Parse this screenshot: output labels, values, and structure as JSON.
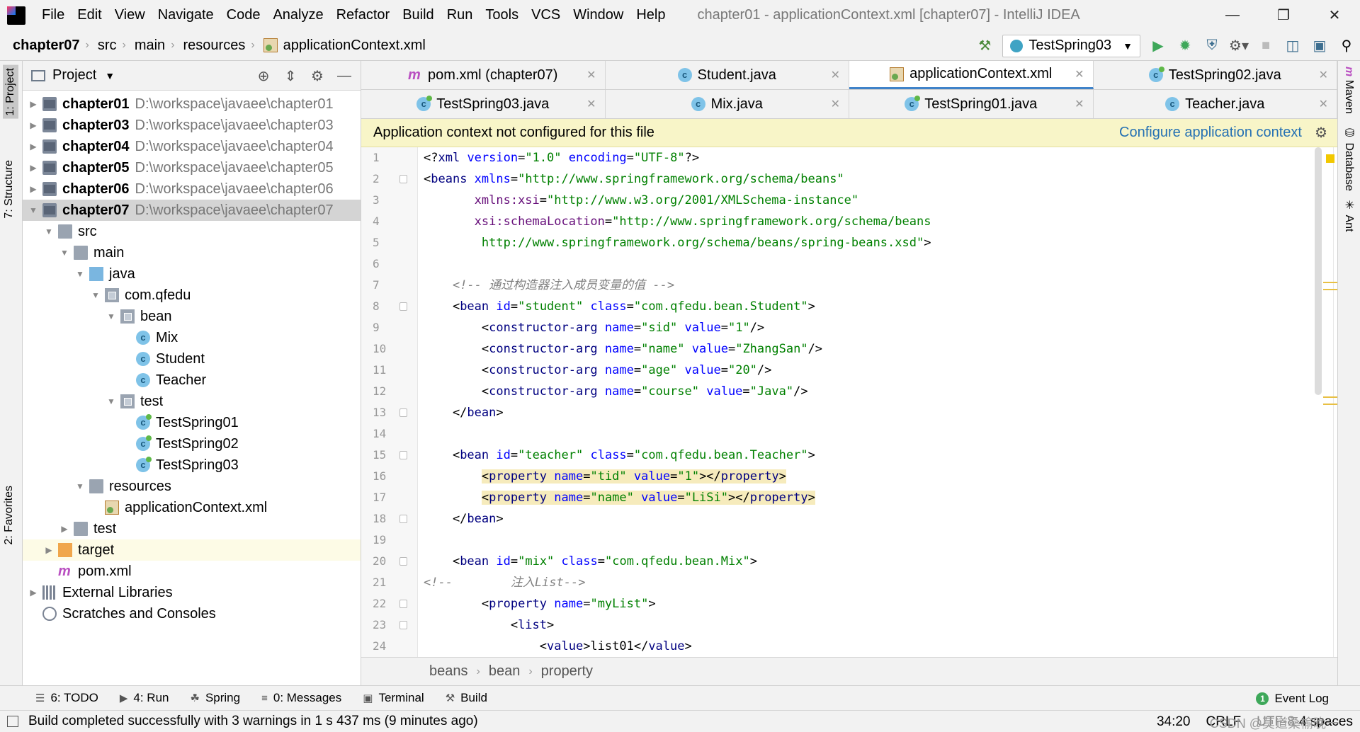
{
  "window": {
    "title": "chapter01 - applicationContext.xml [chapter07] - IntelliJ IDEA"
  },
  "menu": [
    {
      "label": "File"
    },
    {
      "label": "Edit"
    },
    {
      "label": "View"
    },
    {
      "label": "Navigate"
    },
    {
      "label": "Code"
    },
    {
      "label": "Analyze"
    },
    {
      "label": "Refactor"
    },
    {
      "label": "Build"
    },
    {
      "label": "Run"
    },
    {
      "label": "Tools"
    },
    {
      "label": "VCS"
    },
    {
      "label": "Window"
    },
    {
      "label": "Help"
    }
  ],
  "navbar": {
    "crumbs": [
      "chapter07",
      "src",
      "main",
      "resources",
      "applicationContext.xml"
    ],
    "run_config": "TestSpring03"
  },
  "left_stripe": {
    "project_tab": "1: Project",
    "structure_tab": "7: Structure",
    "favorites_tab": "2: Favorites"
  },
  "right_stripe": {
    "maven_tab": "Maven",
    "database_tab": "Database",
    "ant_tab": "Ant"
  },
  "project_panel": {
    "title": "Project",
    "tree": [
      {
        "name": "chapter01",
        "path": "D:\\workspace\\javaee\\chapter01",
        "icon": "module-icon",
        "depth": 0,
        "arrow": "collapsed",
        "bold": true
      },
      {
        "name": "chapter03",
        "path": "D:\\workspace\\javaee\\chapter03",
        "icon": "module-icon",
        "depth": 0,
        "arrow": "collapsed",
        "bold": true
      },
      {
        "name": "chapter04",
        "path": "D:\\workspace\\javaee\\chapter04",
        "icon": "module-icon",
        "depth": 0,
        "arrow": "collapsed",
        "bold": true
      },
      {
        "name": "chapter05",
        "path": "D:\\workspace\\javaee\\chapter05",
        "icon": "module-icon",
        "depth": 0,
        "arrow": "collapsed",
        "bold": true
      },
      {
        "name": "chapter06",
        "path": "D:\\workspace\\javaee\\chapter06",
        "icon": "module-icon",
        "depth": 0,
        "arrow": "collapsed",
        "bold": true
      },
      {
        "name": "chapter07",
        "path": "D:\\workspace\\javaee\\chapter07",
        "icon": "module-icon",
        "depth": 0,
        "arrow": "expanded",
        "bold": true,
        "selected": true
      },
      {
        "name": "src",
        "path": "",
        "icon": "folder-icon",
        "depth": 1,
        "arrow": "expanded"
      },
      {
        "name": "main",
        "path": "",
        "icon": "folder-icon",
        "depth": 2,
        "arrow": "expanded"
      },
      {
        "name": "java",
        "path": "",
        "icon": "source-folder-icon",
        "depth": 3,
        "arrow": "expanded"
      },
      {
        "name": "com.qfedu",
        "path": "",
        "icon": "package-icon",
        "depth": 4,
        "arrow": "expanded"
      },
      {
        "name": "bean",
        "path": "",
        "icon": "package-icon",
        "depth": 5,
        "arrow": "expanded"
      },
      {
        "name": "Mix",
        "path": "",
        "icon": "class-icon",
        "depth": 6,
        "arrow": "none"
      },
      {
        "name": "Student",
        "path": "",
        "icon": "class-icon",
        "depth": 6,
        "arrow": "none"
      },
      {
        "name": "Teacher",
        "path": "",
        "icon": "class-icon",
        "depth": 6,
        "arrow": "none"
      },
      {
        "name": "test",
        "path": "",
        "icon": "package-icon",
        "depth": 5,
        "arrow": "expanded"
      },
      {
        "name": "TestSpring01",
        "path": "",
        "icon": "test-class-icon",
        "depth": 6,
        "arrow": "none"
      },
      {
        "name": "TestSpring02",
        "path": "",
        "icon": "test-class-icon",
        "depth": 6,
        "arrow": "none"
      },
      {
        "name": "TestSpring03",
        "path": "",
        "icon": "test-class-icon",
        "depth": 6,
        "arrow": "none"
      },
      {
        "name": "resources",
        "path": "",
        "icon": "resources-folder-icon",
        "depth": 3,
        "arrow": "expanded"
      },
      {
        "name": "applicationContext.xml",
        "path": "",
        "icon": "xml-file-icon",
        "depth": 4,
        "arrow": "none"
      },
      {
        "name": "test",
        "path": "",
        "icon": "folder-icon",
        "depth": 2,
        "arrow": "collapsed"
      },
      {
        "name": "target",
        "path": "",
        "icon": "excluded-folder-icon",
        "depth": 1,
        "arrow": "collapsed",
        "highlight": true
      },
      {
        "name": "pom.xml",
        "path": "",
        "icon": "maven-file-icon",
        "depth": 1,
        "arrow": "none"
      },
      {
        "name": "External Libraries",
        "path": "",
        "icon": "libraries-icon",
        "depth": 0,
        "arrow": "collapsed"
      },
      {
        "name": "Scratches and Consoles",
        "path": "",
        "icon": "scratches-icon",
        "depth": 0,
        "arrow": "none"
      }
    ]
  },
  "editor_tabs": {
    "row1": [
      {
        "label": "pom.xml (chapter07)",
        "icon": "maven-file-icon"
      },
      {
        "label": "Student.java",
        "icon": "class-icon"
      },
      {
        "label": "applicationContext.xml",
        "icon": "xml-file-icon",
        "active": true
      },
      {
        "label": "TestSpring02.java",
        "icon": "test-class-icon"
      }
    ],
    "row2": [
      {
        "label": "TestSpring03.java",
        "icon": "test-class-icon"
      },
      {
        "label": "Mix.java",
        "icon": "class-icon"
      },
      {
        "label": "TestSpring01.java",
        "icon": "test-class-icon"
      },
      {
        "label": "Teacher.java",
        "icon": "class-icon"
      }
    ]
  },
  "notification": {
    "message": "Application context not configured for this file",
    "link": "Configure application context"
  },
  "code_lines": [
    [
      [
        "pun",
        "<?"
      ],
      [
        "tag",
        "xml "
      ],
      [
        "attr",
        "version"
      ],
      [
        "pun",
        "="
      ],
      [
        "val",
        "\"1.0\""
      ],
      [
        "pun",
        " "
      ],
      [
        "attr",
        "encoding"
      ],
      [
        "pun",
        "="
      ],
      [
        "val",
        "\"UTF-8\""
      ],
      [
        "pun",
        "?>"
      ]
    ],
    [
      [
        "pun",
        "<"
      ],
      [
        "tag",
        "beans "
      ],
      [
        "attr",
        "xmlns"
      ],
      [
        "pun",
        "="
      ],
      [
        "val",
        "\"http://www.springframework.org/schema/beans\""
      ]
    ],
    [
      [
        "pun",
        "       "
      ],
      [
        "ns",
        "xmlns:xsi"
      ],
      [
        "pun",
        "="
      ],
      [
        "val",
        "\"http://www.w3.org/2001/XMLSchema-instance\""
      ]
    ],
    [
      [
        "pun",
        "       "
      ],
      [
        "ns",
        "xsi:schemaLocation"
      ],
      [
        "pun",
        "="
      ],
      [
        "val",
        "\"http://www.springframework.org/schema/beans"
      ]
    ],
    [
      [
        "pun",
        "        "
      ],
      [
        "val",
        "http://www.springframework.org/schema/beans/spring-beans.xsd\""
      ],
      [
        "pun",
        ">"
      ]
    ],
    [
      [
        "pun",
        ""
      ]
    ],
    [
      [
        "pun",
        "    "
      ],
      [
        "cmt",
        "<!-- 通过构造器注入成员变量的值 -->"
      ]
    ],
    [
      [
        "pun",
        "    <"
      ],
      [
        "tag",
        "bean "
      ],
      [
        "attr",
        "id"
      ],
      [
        "pun",
        "="
      ],
      [
        "val",
        "\"student\""
      ],
      [
        "pun",
        " "
      ],
      [
        "attr",
        "class"
      ],
      [
        "pun",
        "="
      ],
      [
        "val",
        "\"com.qfedu.bean.Student\""
      ],
      [
        "pun",
        ">"
      ]
    ],
    [
      [
        "pun",
        "        <"
      ],
      [
        "tag",
        "constructor-arg "
      ],
      [
        "attr",
        "name"
      ],
      [
        "pun",
        "="
      ],
      [
        "val",
        "\"sid\""
      ],
      [
        "pun",
        " "
      ],
      [
        "attr",
        "value"
      ],
      [
        "pun",
        "="
      ],
      [
        "val",
        "\"1\""
      ],
      [
        "pun",
        "/>"
      ]
    ],
    [
      [
        "pun",
        "        <"
      ],
      [
        "tag",
        "constructor-arg "
      ],
      [
        "attr",
        "name"
      ],
      [
        "pun",
        "="
      ],
      [
        "val",
        "\"name\""
      ],
      [
        "pun",
        " "
      ],
      [
        "attr",
        "value"
      ],
      [
        "pun",
        "="
      ],
      [
        "val",
        "\"ZhangSan\""
      ],
      [
        "pun",
        "/>"
      ]
    ],
    [
      [
        "pun",
        "        <"
      ],
      [
        "tag",
        "constructor-arg "
      ],
      [
        "attr",
        "name"
      ],
      [
        "pun",
        "="
      ],
      [
        "val",
        "\"age\""
      ],
      [
        "pun",
        " "
      ],
      [
        "attr",
        "value"
      ],
      [
        "pun",
        "="
      ],
      [
        "val",
        "\"20\""
      ],
      [
        "pun",
        "/>"
      ]
    ],
    [
      [
        "pun",
        "        <"
      ],
      [
        "tag",
        "constructor-arg "
      ],
      [
        "attr",
        "name"
      ],
      [
        "pun",
        "="
      ],
      [
        "val",
        "\"course\""
      ],
      [
        "pun",
        " "
      ],
      [
        "attr",
        "value"
      ],
      [
        "pun",
        "="
      ],
      [
        "val",
        "\"Java\""
      ],
      [
        "pun",
        "/>"
      ]
    ],
    [
      [
        "pun",
        "    </"
      ],
      [
        "tag",
        "bean"
      ],
      [
        "pun",
        ">"
      ]
    ],
    [
      [
        "pun",
        ""
      ]
    ],
    [
      [
        "pun",
        "    <"
      ],
      [
        "tag",
        "bean "
      ],
      [
        "attr",
        "id"
      ],
      [
        "pun",
        "="
      ],
      [
        "val",
        "\"teacher\""
      ],
      [
        "pun",
        " "
      ],
      [
        "attr",
        "class"
      ],
      [
        "pun",
        "="
      ],
      [
        "val",
        "\"com.qfedu.bean.Teacher\""
      ],
      [
        "pun",
        ">"
      ]
    ],
    [
      [
        "pun",
        "        "
      ],
      [
        "hl",
        "<"
      ],
      [
        "hltag",
        "property "
      ],
      [
        "hlattr",
        "name"
      ],
      [
        "hl",
        "="
      ],
      [
        "hlval",
        "\"tid\""
      ],
      [
        "hl",
        " "
      ],
      [
        "hlattr",
        "value"
      ],
      [
        "hl",
        "="
      ],
      [
        "hlval",
        "\"1\""
      ],
      [
        "hl",
        "></"
      ],
      [
        "hltag",
        "property"
      ],
      [
        "hl",
        ">"
      ]
    ],
    [
      [
        "pun",
        "        "
      ],
      [
        "hl",
        "<"
      ],
      [
        "hltag",
        "property "
      ],
      [
        "hlattr",
        "name"
      ],
      [
        "hl",
        "="
      ],
      [
        "hlval",
        "\"name\""
      ],
      [
        "hl",
        " "
      ],
      [
        "hlattr",
        "value"
      ],
      [
        "hl",
        "="
      ],
      [
        "hlval",
        "\"LiSi\""
      ],
      [
        "hl",
        "></"
      ],
      [
        "hltag",
        "property"
      ],
      [
        "hl",
        ">"
      ]
    ],
    [
      [
        "pun",
        "    </"
      ],
      [
        "tag",
        "bean"
      ],
      [
        "pun",
        ">"
      ]
    ],
    [
      [
        "pun",
        ""
      ]
    ],
    [
      [
        "pun",
        "    <"
      ],
      [
        "tag",
        "bean "
      ],
      [
        "attr",
        "id"
      ],
      [
        "pun",
        "="
      ],
      [
        "val",
        "\"mix\""
      ],
      [
        "pun",
        " "
      ],
      [
        "attr",
        "class"
      ],
      [
        "pun",
        "="
      ],
      [
        "val",
        "\"com.qfedu.bean.Mix\""
      ],
      [
        "pun",
        ">"
      ]
    ],
    [
      [
        "cmt",
        "<!--        注入List-->"
      ]
    ],
    [
      [
        "pun",
        "        <"
      ],
      [
        "tag",
        "property "
      ],
      [
        "attr",
        "name"
      ],
      [
        "pun",
        "="
      ],
      [
        "val",
        "\"myList\""
      ],
      [
        "pun",
        ">"
      ]
    ],
    [
      [
        "pun",
        "            <"
      ],
      [
        "tag",
        "list"
      ],
      [
        "pun",
        ">"
      ]
    ],
    [
      [
        "pun",
        "                <"
      ],
      [
        "tag",
        "value"
      ],
      [
        "pun",
        ">list01</"
      ],
      [
        "tag",
        "value"
      ],
      [
        "pun",
        ">"
      ]
    ]
  ],
  "editor_breadcrumbs": [
    "beans",
    "bean",
    "property"
  ],
  "tool_windows": [
    {
      "label": "6: TODO",
      "icon": "todo-icon"
    },
    {
      "label": "4: Run",
      "icon": "run-icon"
    },
    {
      "label": "Spring",
      "icon": "spring-icon"
    },
    {
      "label": "0: Messages",
      "icon": "messages-icon"
    },
    {
      "label": "Terminal",
      "icon": "terminal-icon"
    },
    {
      "label": "Build",
      "icon": "build-icon"
    }
  ],
  "event_log": {
    "label": "Event Log",
    "count": "1"
  },
  "status": {
    "message": "Build completed successfully with 3 warnings in 1 s 437 ms (9 minutes ago)",
    "position": "34:20",
    "line_sep": "CRLF",
    "encoding": "UTF-8",
    "indent": "4 spaces",
    "watermark": "CSDN @莫道桑榆晚一"
  },
  "colors": {
    "accent": "#4083c9",
    "notification_bg": "#f8f5c8",
    "highlight_bg": "#f6ebbc",
    "link": "#2470b3"
  }
}
